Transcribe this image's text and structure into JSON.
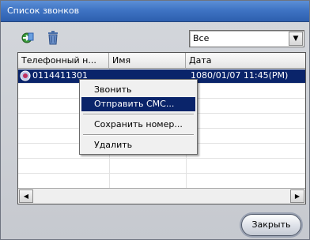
{
  "window": {
    "title": "Список звонков"
  },
  "toolbar": {
    "import_icon": "import-contact-icon",
    "delete_icon": "trash-icon",
    "filter": {
      "value": "Все"
    }
  },
  "table": {
    "columns": [
      "Телефонный н...",
      "Имя",
      "Дата"
    ],
    "rows": [
      {
        "phone": "0114411301",
        "name": "",
        "date": "1080/01/07 11:45(PM)",
        "selected": true
      }
    ]
  },
  "context_menu": {
    "items": [
      "Звонить",
      "Отправить СМС...",
      "Сохранить номер...",
      "Удалить"
    ],
    "active_index": 1
  },
  "footer": {
    "close_label": "Закрыть"
  },
  "colors": {
    "title_bar": "#3f74c4",
    "selection": "#0a246a"
  }
}
